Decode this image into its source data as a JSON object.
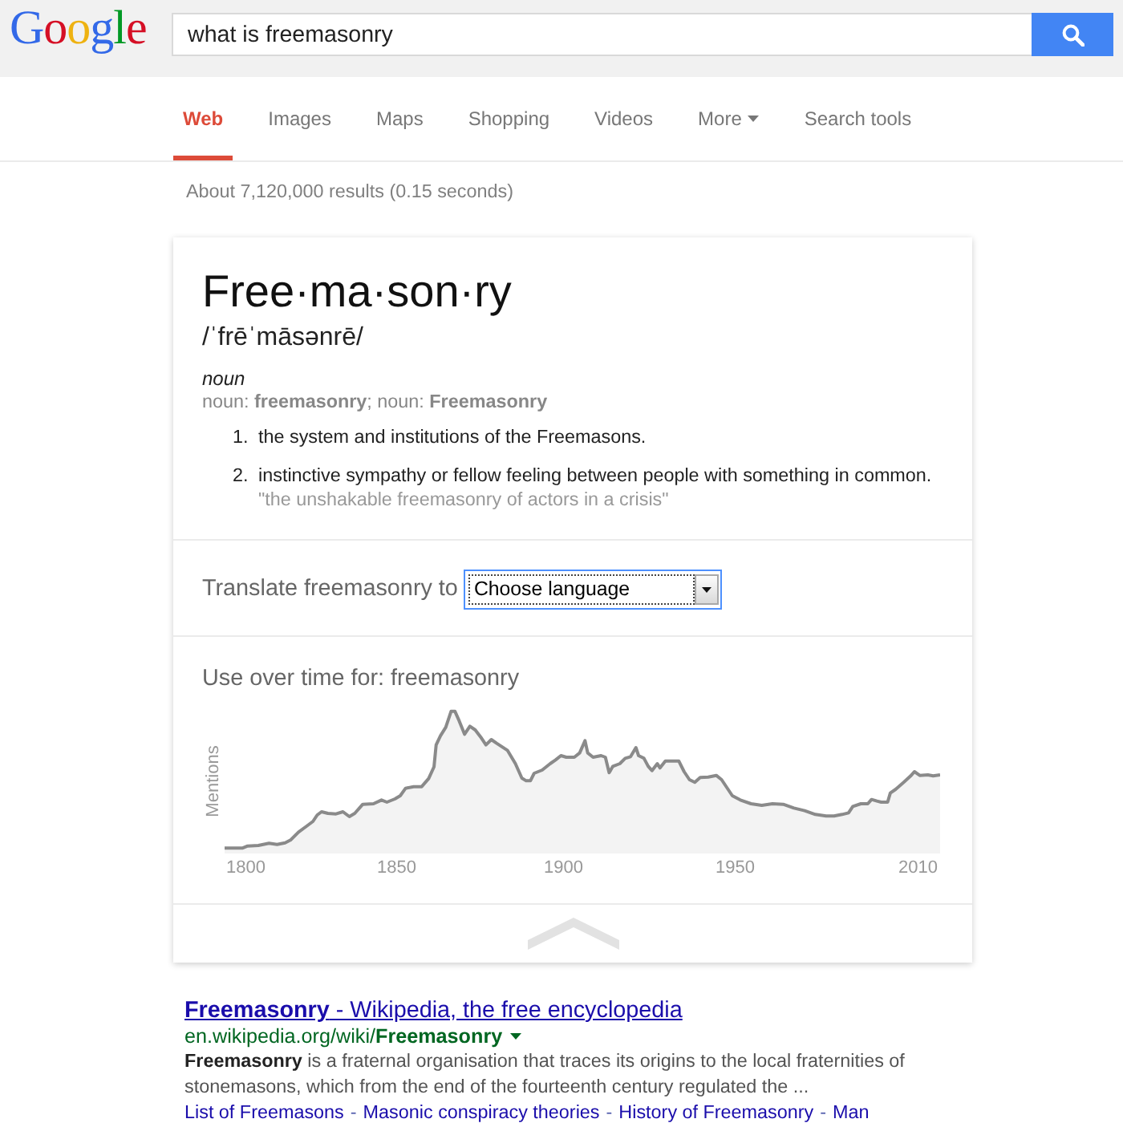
{
  "header": {
    "logo": "Google",
    "search": {
      "value": "what is freemasonry"
    }
  },
  "tabs": [
    {
      "label": "Web",
      "selected": true,
      "kind": "tab"
    },
    {
      "label": "Images",
      "selected": false,
      "kind": "tab"
    },
    {
      "label": "Maps",
      "selected": false,
      "kind": "tab"
    },
    {
      "label": "Shopping",
      "selected": false,
      "kind": "tab"
    },
    {
      "label": "Videos",
      "selected": false,
      "kind": "tab"
    },
    {
      "label": "More",
      "selected": false,
      "kind": "menu"
    },
    {
      "label": "Search tools",
      "selected": false,
      "kind": "tab"
    }
  ],
  "result_stats": "About 7,120,000 results (0.15 seconds)",
  "definition": {
    "headword": "Free·ma·son·ry",
    "pronunciation": "/ˈfrēˈmāsənrē/",
    "part_of_speech": "noun",
    "forms": "noun: **freemasonry**; noun: **Freemasonry**",
    "senses": [
      {
        "number": "1.",
        "text": "the system and institutions of the Freemasons."
      },
      {
        "number": "2.",
        "text": "instinctive sympathy or fellow feeling between people with something in common.",
        "example": "\"the unshakable freemasonry of actors in a crisis\""
      }
    ]
  },
  "translate": {
    "label": "Translate freemasonry to",
    "select": {
      "value": "Choose language"
    }
  },
  "usage": {
    "title": "Use over time for: freemasonry",
    "ylabel": "Mentions",
    "xtick_labels": [
      "1800",
      "1850",
      "1900",
      "1950",
      "2010"
    ]
  },
  "result": {
    "title": "**Freemasonry** - Wikipedia, the free encyclopedia",
    "url": "en.wikipedia.org/wiki/**Freemasonry**",
    "snippet": "**Freemasonry** is a fraternal organisation that traces its origins to the local fraternities of stonemasons, which from the end of the fourteenth century regulated the ...",
    "sitelinks": [
      {
        "kind": "link",
        "text": "List of Freemasons"
      },
      {
        "kind": "separator",
        "text": "-"
      },
      {
        "kind": "link",
        "text": "Masonic conspiracy theories"
      },
      {
        "kind": "separator",
        "text": "-"
      },
      {
        "kind": "link",
        "text": "History of Freemasonry"
      },
      {
        "kind": "separator",
        "text": "-"
      },
      {
        "kind": "link",
        "text": "Man"
      }
    ]
  }
}
